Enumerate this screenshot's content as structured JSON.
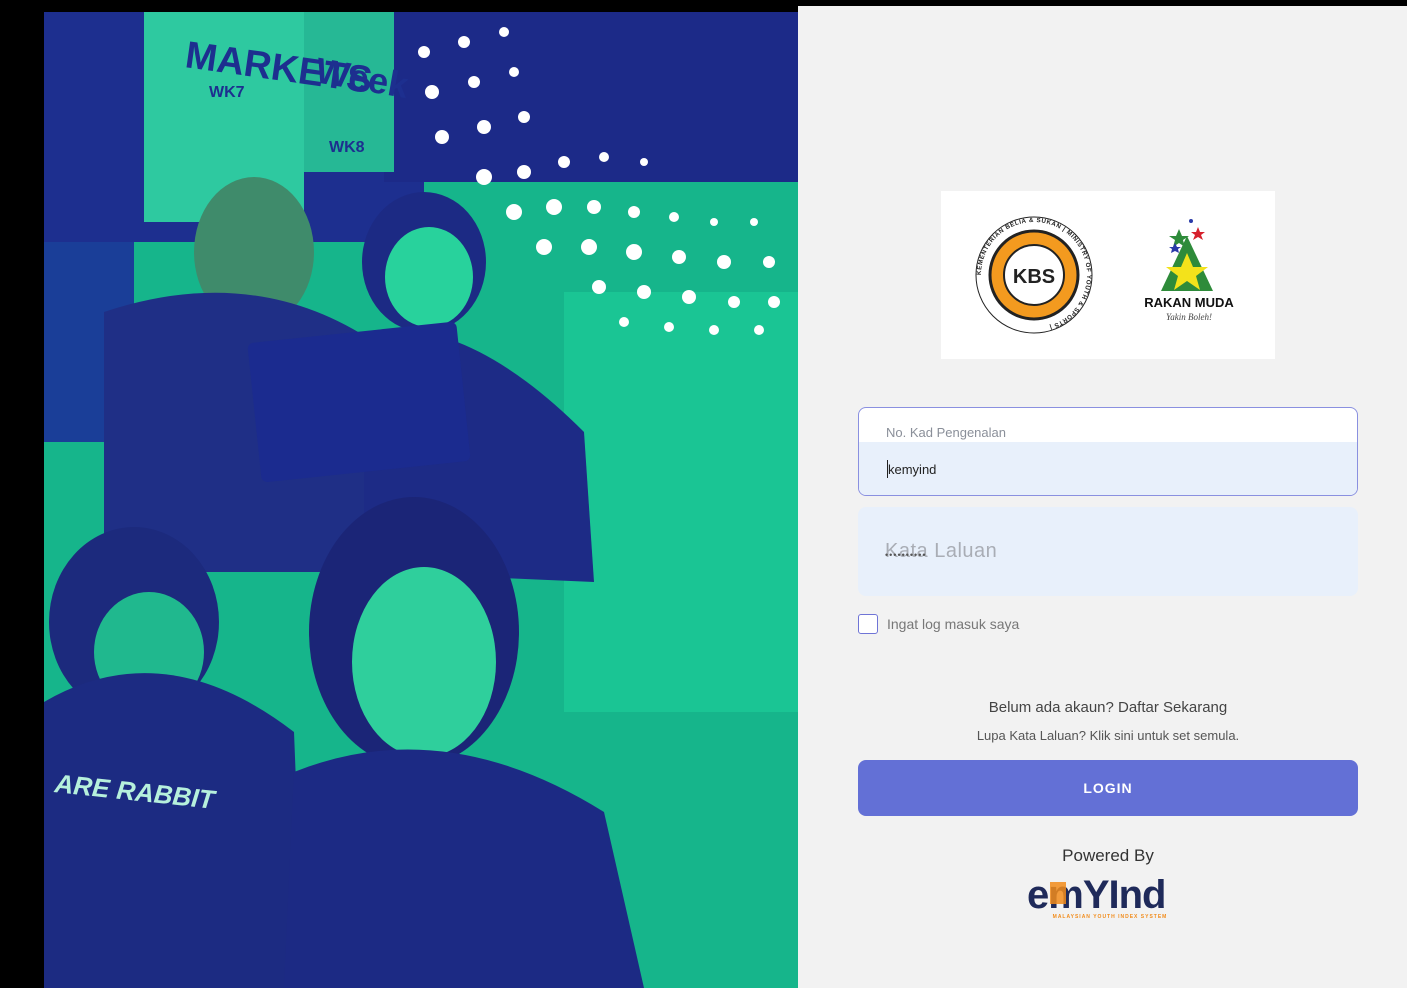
{
  "hero": {
    "tshirt_text": "ARE RABBIT",
    "banner_text": "MARKETS",
    "sign_text": "Week",
    "tag1": "WK7",
    "tag2": "WK8"
  },
  "logos": {
    "kbs_text": "KBS",
    "kbs_ring": "KEMENTERIAN BELIA & SUKAN | MINISTRY OF YOUTH & SPORTS |",
    "rakan_muda": "RAKAN MUDA",
    "rakan_tagline": "Yakin Boleh!"
  },
  "form": {
    "ic_label": "No. Kad Pengenalan",
    "ic_value": "kemyind",
    "password_placeholder": "Kata Laluan",
    "password_dots": "••••••••••",
    "remember_label": "Ingat log masuk saya",
    "register_text": "Belum ada akaun? Daftar Sekarang",
    "forgot_text": "Lupa Kata Laluan? Klik sini untuk set semula.",
    "login_label": "LOGIN"
  },
  "footer": {
    "powered_by": "Powered By",
    "brand": "emYInd",
    "brand_tagline": "MALAYSIAN YOUTH INDEX SYSTEM"
  },
  "colors": {
    "accent": "#6370d6",
    "field_bg": "#e8f0fb",
    "hero_green": "#1fd19b",
    "hero_blue": "#1b2a86",
    "brand_orange": "#f28c1b"
  }
}
